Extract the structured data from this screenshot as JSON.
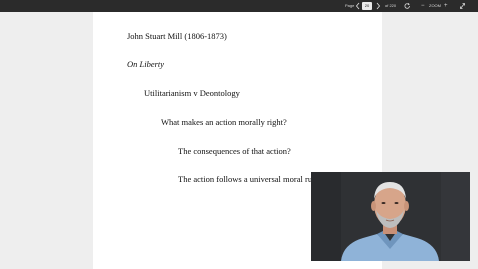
{
  "toolbar": {
    "page_label": "Page",
    "page_value": "20",
    "page_total": "of 220",
    "zoom_label": "ZOOM",
    "zoom_out": "−",
    "zoom_in": "+",
    "prev_icon": "chevron-left-icon",
    "next_icon": "chevron-right-icon",
    "rotate_icon": "rotate-icon",
    "fullscreen_icon": "expand-icon"
  },
  "document": {
    "lines": [
      "John Stuart Mill (1806-1873)",
      "On Liberty",
      "Utilitarianism v Deontology",
      "What makes an action morally right?",
      "The consequences of that action?",
      "The action follows a universal moral ru"
    ]
  },
  "video": {
    "subject": "presenter webcam",
    "colors": {
      "background": "#2f3134",
      "shirt": "#8fb3d8",
      "skin": "#d7a58a"
    }
  }
}
